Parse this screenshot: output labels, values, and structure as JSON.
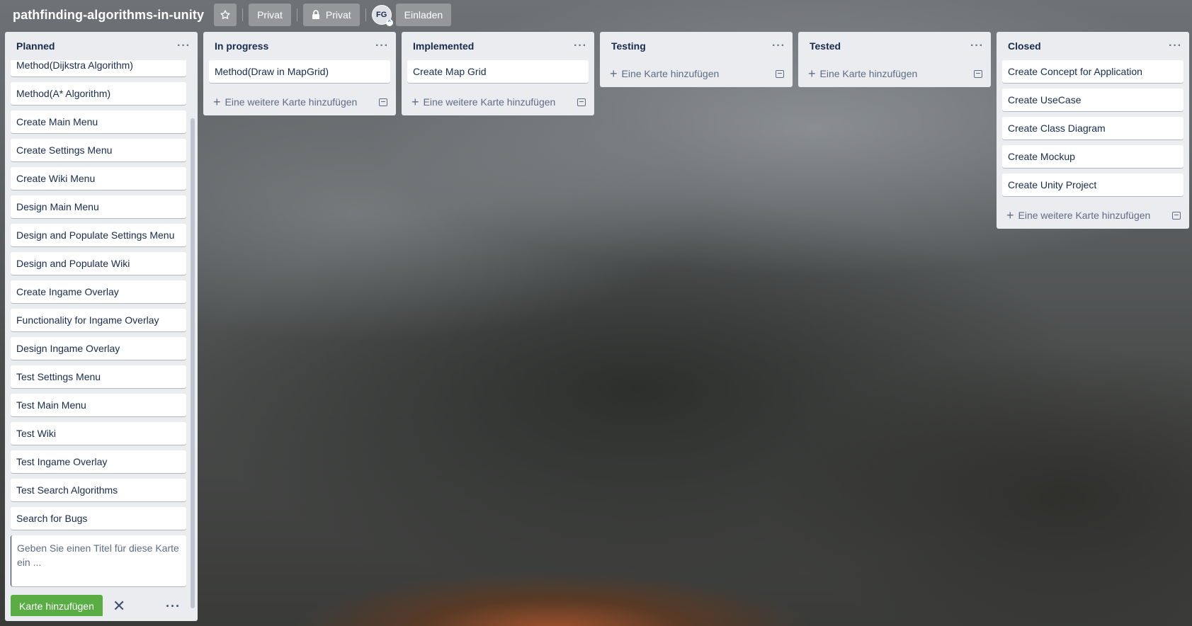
{
  "header": {
    "board_title": "pathfinding-algorithms-in-unity",
    "visibility_label": "Privat",
    "team_label": "Privat",
    "avatar_initials": "FG",
    "invite_label": "Einladen",
    "star_icon": "star-icon",
    "lock_icon": "lock-icon"
  },
  "lists": {
    "planned": {
      "title": "Planned",
      "cards": [
        "Method(Dijkstra Algorithm)",
        "Method(A* Algorithm)",
        "Create Main Menu",
        "Create Settings Menu",
        "Create Wiki Menu",
        "Design Main Menu",
        "Design and Populate Settings Menu",
        "Design and Populate Wiki",
        "Create Ingame Overlay",
        "Functionality for Ingame Overlay",
        "Design Ingame Overlay",
        "Test Settings Menu",
        "Test Main Menu",
        "Test Wiki",
        "Test Ingame Overlay",
        "Test Search Algorithms",
        "Search for Bugs"
      ],
      "composer_placeholder": "Geben Sie einen Titel für diese Karte ein ...",
      "add_card_button": "Karte hinzufügen"
    },
    "in_progress": {
      "title": "In progress",
      "cards": [
        "Method(Draw in MapGrid)"
      ],
      "add_label": "Eine weitere Karte hinzufügen"
    },
    "implemented": {
      "title": "Implemented",
      "cards": [
        "Create Map Grid"
      ],
      "add_label": "Eine weitere Karte hinzufügen"
    },
    "testing": {
      "title": "Testing",
      "cards": [],
      "add_label": "Eine Karte hinzufügen"
    },
    "tested": {
      "title": "Tested",
      "cards": [],
      "add_label": "Eine Karte hinzufügen"
    },
    "closed": {
      "title": "Closed",
      "cards": [
        "Create Concept for Application",
        "Create UseCase",
        "Create Class Diagram",
        "Create Mockup",
        "Create Unity Project"
      ],
      "add_label": "Eine weitere Karte hinzufügen"
    }
  },
  "colors": {
    "list_bg": "#ebecf0",
    "card_bg": "#ffffff",
    "primary_button": "#5aac44",
    "header_button_bg": "rgba(255,255,255,0.28)"
  }
}
